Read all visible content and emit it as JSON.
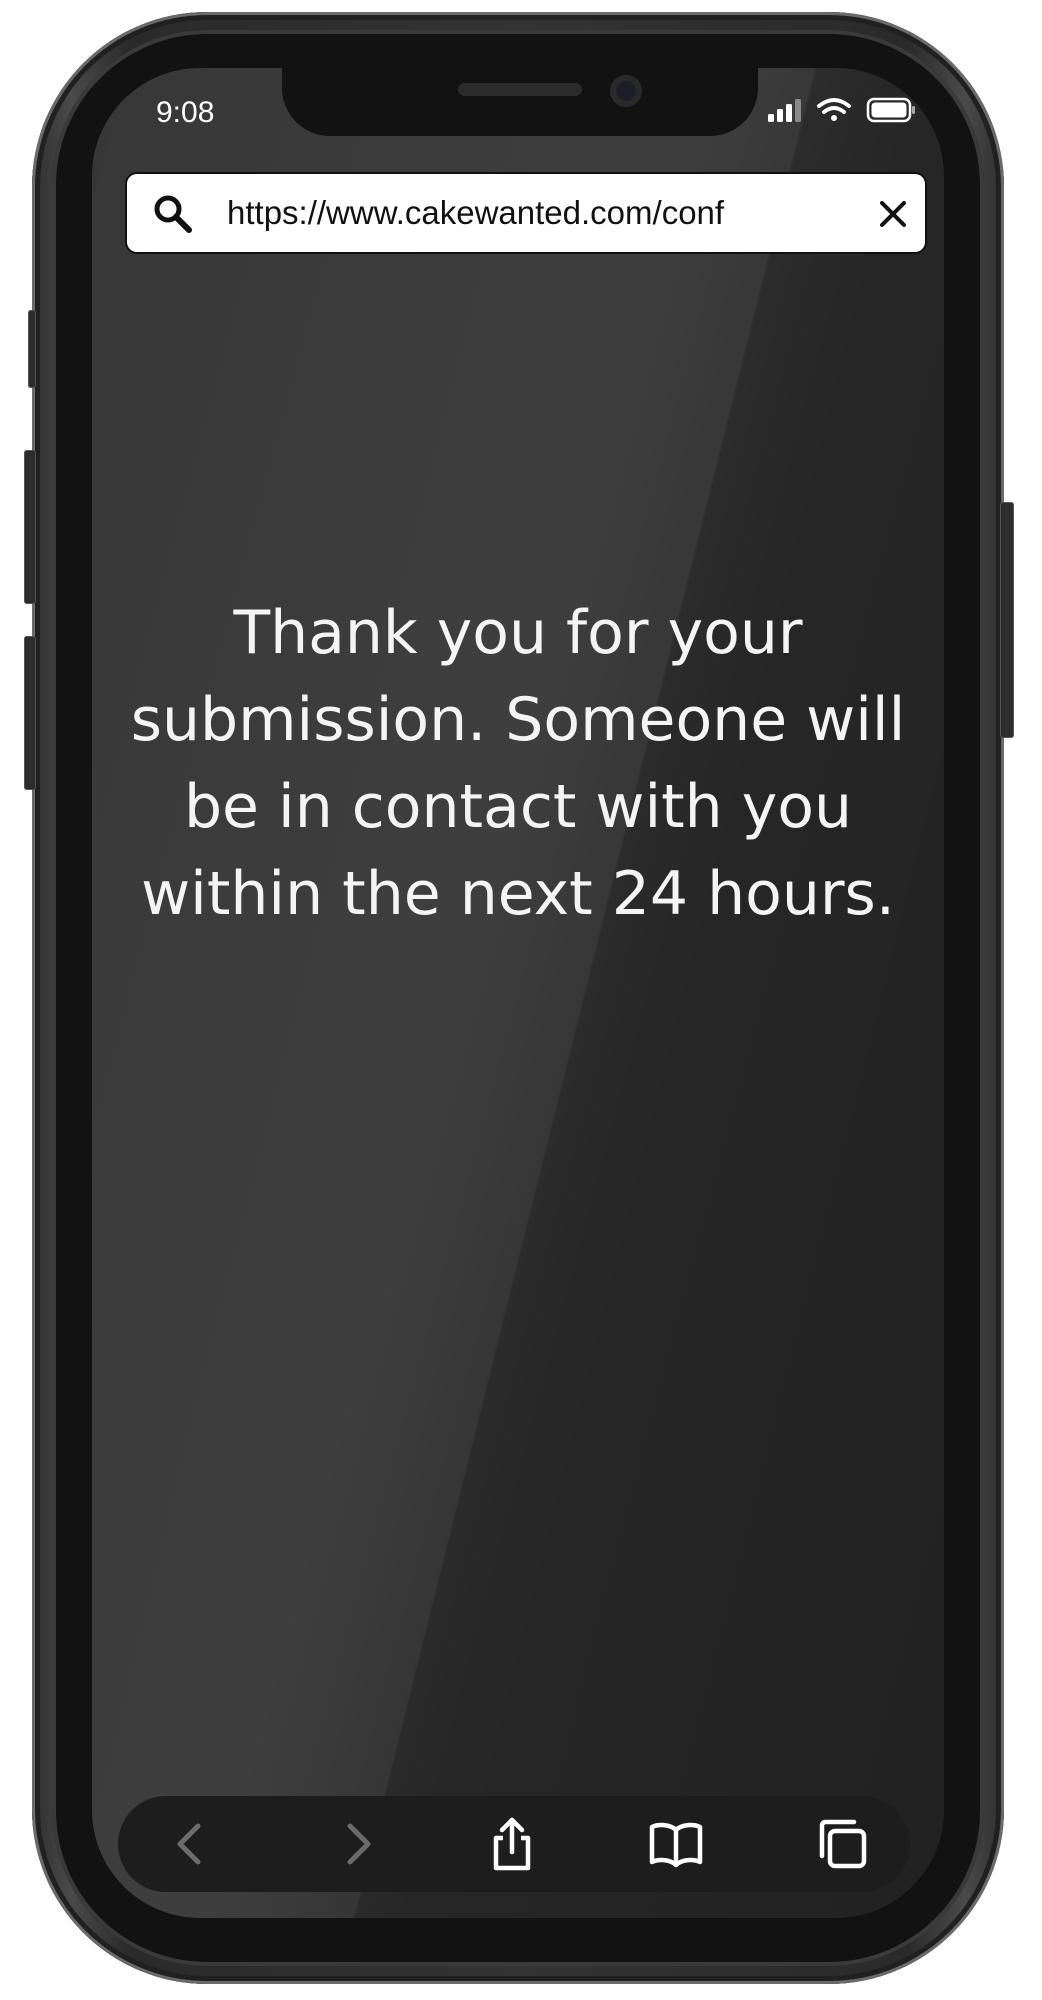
{
  "status_bar": {
    "time": "9:08"
  },
  "browser": {
    "url": "https://www.cakewanted.com/conf"
  },
  "page": {
    "message": "Thank you for your submission. Someone will be in contact with you within the next 24 hours."
  },
  "toolbar": {
    "buttons": [
      {
        "icon": "back-icon",
        "enabled": false
      },
      {
        "icon": "forward-icon",
        "enabled": false
      },
      {
        "icon": "share-icon",
        "enabled": true
      },
      {
        "icon": "bookmarks-icon",
        "enabled": true
      },
      {
        "icon": "tabs-icon",
        "enabled": true
      }
    ]
  },
  "colors": {
    "screen_background": "#2b2b2b",
    "text": "#f4f4f4",
    "toolbar_background": "#1d1d1d",
    "disabled_icon": "#6b6b6b"
  }
}
